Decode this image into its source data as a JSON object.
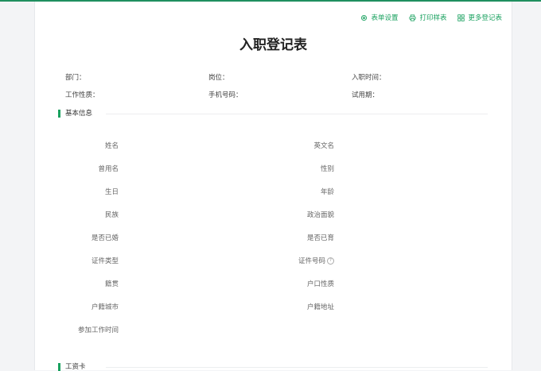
{
  "toolbar": {
    "form_settings": "表单设置",
    "print_sample": "打印样表",
    "more_forms": "更多登记表"
  },
  "title": "入职登记表",
  "meta": {
    "department": "部门：",
    "position": "岗位：",
    "hire_date": "入职时间：",
    "job_nature": "工作性质：",
    "phone": "手机号码：",
    "probation": "试用期："
  },
  "sections": {
    "basic_info": "基本信息",
    "salary_card": "工资卡"
  },
  "fields": {
    "name": "姓名",
    "english_name": "英文名",
    "former_name": "曾用名",
    "gender": "性别",
    "birthday": "生日",
    "age": "年龄",
    "ethnicity": "民族",
    "political_status": "政治面貌",
    "married": "是否已婚",
    "has_children": "是否已育",
    "id_type": "证件类型",
    "id_number": "证件号码",
    "native_place": "籍贯",
    "household_type": "户口性质",
    "household_city": "户籍城市",
    "household_address": "户籍地址",
    "work_start_date": "参加工作时间"
  },
  "colors": {
    "accent": "#19a15f",
    "top_bar": "#1f8f5f"
  }
}
